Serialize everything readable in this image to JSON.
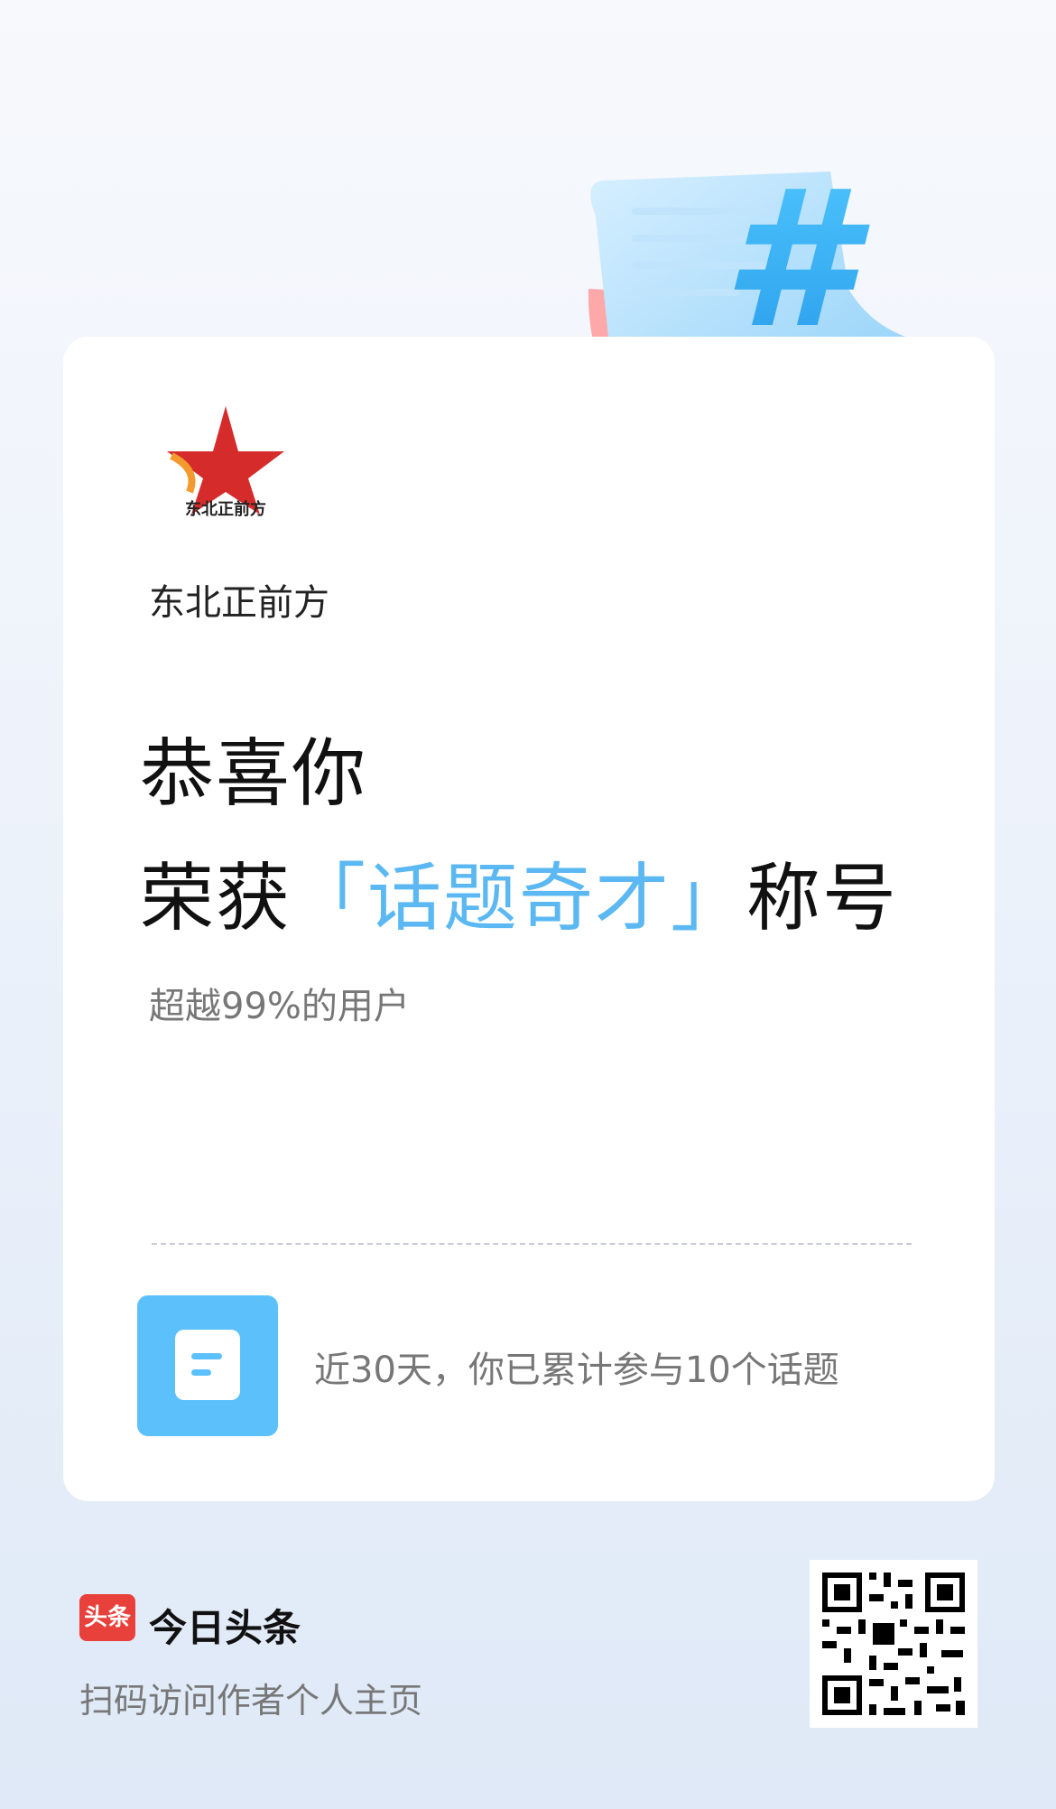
{
  "author": {
    "name": "东北正前方",
    "logo_text": "东北正前方"
  },
  "headline": {
    "line1": "恭喜你",
    "line2_prefix": "荣获",
    "line2_highlight": "「话题奇才」",
    "line2_suffix": "称号"
  },
  "rank_text": "超越99%的用户",
  "stat_text": "近30天，你已累计参与10个话题",
  "footer": {
    "badge_text": "头条",
    "app_name": "今日头条",
    "scan_text": "扫码访问作者个人主页"
  },
  "colors": {
    "highlight": "#5bb8f2",
    "icon_box": "#5cc1fb",
    "badge": "#e8413c"
  },
  "icons": [
    "hash-icon",
    "document-icon",
    "qr-code-icon",
    "star-logo-icon"
  ]
}
